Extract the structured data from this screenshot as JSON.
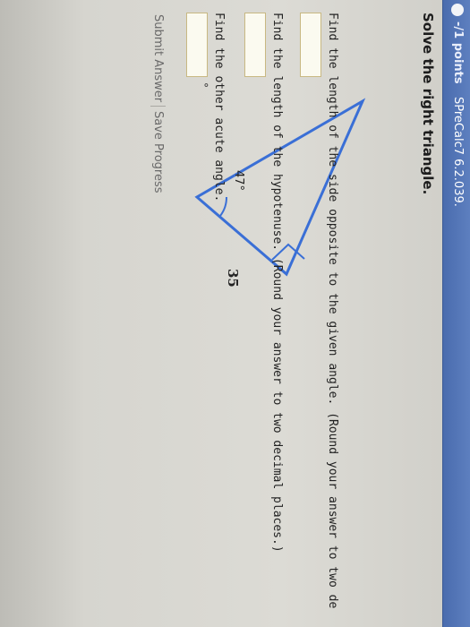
{
  "header": {
    "points": "-/1 points",
    "source": "SPreCalc7 6.2.039."
  },
  "instruction": "Solve the right triangle.",
  "triangle": {
    "angle_label": "47°",
    "side_label": "35"
  },
  "questions": [
    {
      "text": "Find the length of the side opposite to the given angle. (Round your answer to two de"
    },
    {
      "text": "Find the length of the hypotenuse. (Round your answer to two decimal places.)"
    },
    {
      "text": "Find the other acute angle.",
      "unit": "°"
    }
  ],
  "buttons": {
    "submit": "Submit Answer",
    "save": "Save Progress"
  },
  "colors": {
    "header": "#4a6cae",
    "triangle_stroke": "#3a6fd6"
  }
}
